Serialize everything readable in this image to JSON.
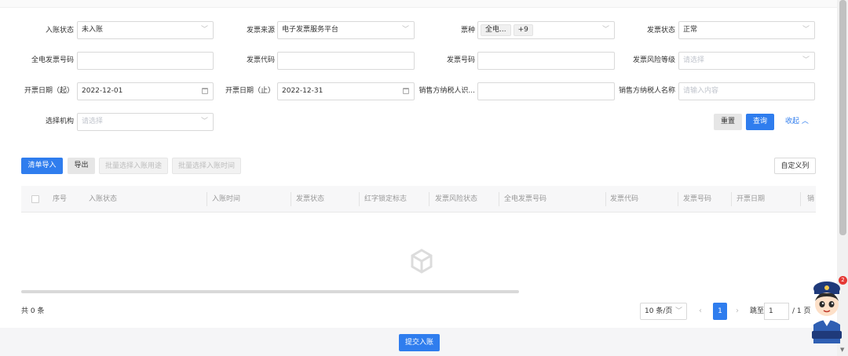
{
  "filters": {
    "entry_status": {
      "label": "入账状态",
      "value": "未入账"
    },
    "invoice_source": {
      "label": "发票来源",
      "value": "电子发票服务平台"
    },
    "invoice_type": {
      "label": "票种",
      "tag": "全电...",
      "more": "+9"
    },
    "invoice_status": {
      "label": "发票状态",
      "value": "正常"
    },
    "full_invoice_no": {
      "label": "全电发票号码",
      "value": ""
    },
    "invoice_code": {
      "label": "发票代码",
      "value": ""
    },
    "invoice_number": {
      "label": "发票号码",
      "value": ""
    },
    "risk_level": {
      "label": "发票风险等级",
      "placeholder": "请选择"
    },
    "date_start": {
      "label": "开票日期（起）",
      "value": "2022-12-01"
    },
    "date_end": {
      "label": "开票日期（止）",
      "value": "2022-12-31"
    },
    "seller_tax_id": {
      "label": "销售方纳税人识...",
      "value": ""
    },
    "seller_name": {
      "label": "销售方纳税人名称",
      "placeholder": "请输入内容"
    },
    "org": {
      "label": "选择机构",
      "placeholder": "请选择"
    }
  },
  "actions": {
    "reset": "重置",
    "query": "查询",
    "collapse": "收起"
  },
  "toolbar": {
    "import_list": "清单导入",
    "export": "导出",
    "batch_purpose": "批量选择入账用途",
    "batch_time": "批量选择入账时间",
    "custom_columns": "自定义列"
  },
  "table": {
    "columns": [
      "序号",
      "入账状态",
      "入账时间",
      "发票状态",
      "红字锁定标志",
      "发票风险状态",
      "全电发票号码",
      "发票代码",
      "发票号码",
      "开票日期",
      "销"
    ]
  },
  "pagination": {
    "total": "共 0 条",
    "page_size": "10 条/页",
    "current_page": "1",
    "goto_label": "跳至",
    "goto_value": "1",
    "total_pages": "/ 1 页"
  },
  "submit": "提交入账",
  "notification_count": "2",
  "colors": {
    "primary": "#2f7dee",
    "badge": "#e53935"
  }
}
